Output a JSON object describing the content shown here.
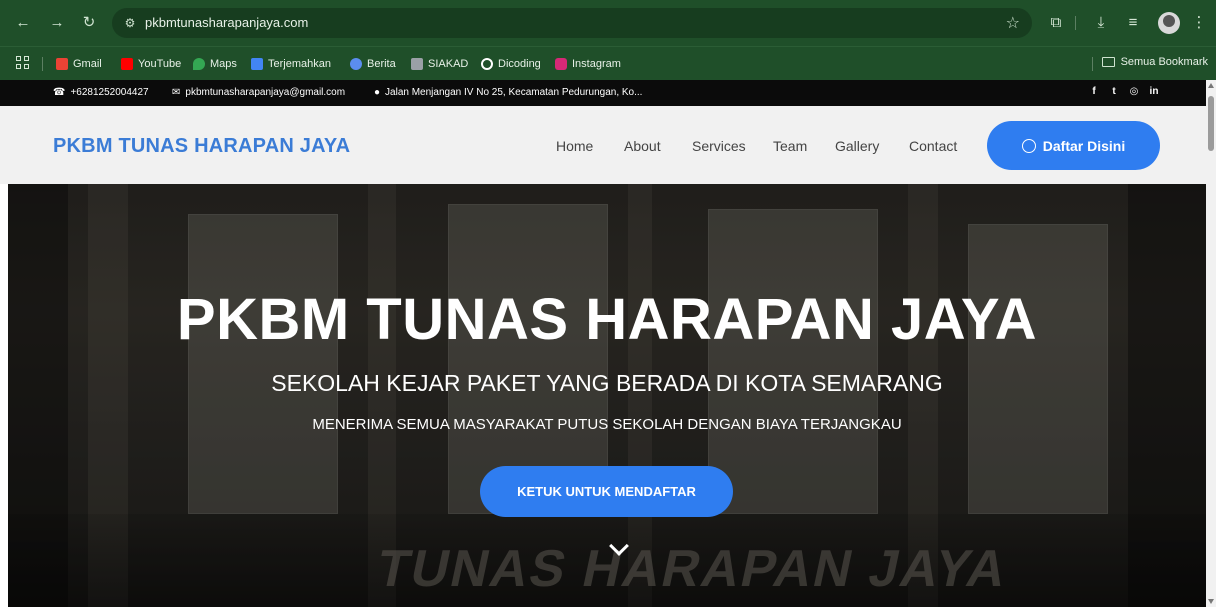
{
  "browser": {
    "url": "pkbmtunasharapanjaya.com",
    "bookmarks": [
      {
        "label": "Gmail",
        "icon": "gmail-icon",
        "color": "#ea4335"
      },
      {
        "label": "YouTube",
        "icon": "youtube-icon",
        "color": "#ff0000"
      },
      {
        "label": "Maps",
        "icon": "maps-icon",
        "color": "#34a853"
      },
      {
        "label": "Terjemahkan",
        "icon": "translate-icon",
        "color": "#4285f4"
      },
      {
        "label": "Berita",
        "icon": "news-icon",
        "color": "#5b8def"
      },
      {
        "label": "SIAKAD",
        "icon": "siakad-icon",
        "color": "#9aa0a6"
      },
      {
        "label": "Dicoding",
        "icon": "dicoding-icon",
        "color": "#ffffff"
      },
      {
        "label": "Instagram",
        "icon": "instagram-icon",
        "color": "#d62976"
      }
    ],
    "all_bookmarks": "Semua Bookmark"
  },
  "topbar": {
    "phone": "+6281252004427",
    "email": "pkbmtunasharapanjaya@gmail.com",
    "address": "Jalan Menjangan IV No 25, Kecamatan Pedurungan, Ko..."
  },
  "header": {
    "logo": "PKBM TUNAS HARAPAN JAYA",
    "nav": [
      "Home",
      "About",
      "Services",
      "Team",
      "Gallery",
      "Contact"
    ],
    "cta": "Daftar Disini"
  },
  "hero": {
    "title": "PKBM TUNAS HARAPAN JAYA",
    "subtitle": "SEKOLAH KEJAR PAKET YANG BERADA DI KOTA SEMARANG",
    "subtitle2": "MENERIMA SEMUA MASYARAKAT PUTUS SEKOLAH DENGAN BIAYA TERJANGKAU",
    "cta": "KETUK UNTUK MENDAFTAR",
    "sign_text": "TUNAS HARAPAN JAYA"
  },
  "colors": {
    "accent": "#2f7df0",
    "logo": "#3b7cd6",
    "chrome": "#1f4f29"
  }
}
